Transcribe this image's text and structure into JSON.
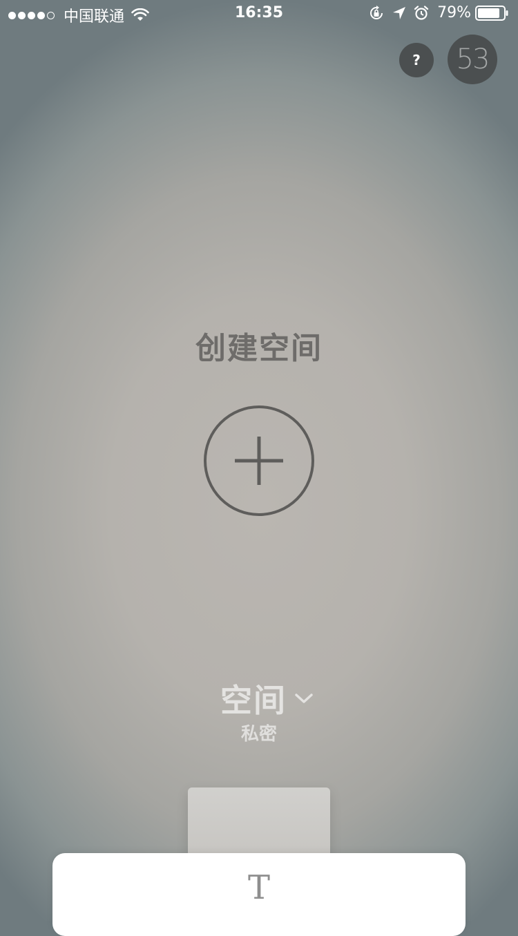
{
  "status_bar": {
    "carrier": "中国联通",
    "time": "16:35",
    "battery": "79%",
    "signal_bars_filled": 4,
    "signal_bars_total": 5
  },
  "header": {
    "help_label": "?",
    "count": "53"
  },
  "main": {
    "title": "创建空间",
    "add_icon": "plus-circle-icon"
  },
  "space_selector": {
    "name": "空间",
    "type": "私密"
  },
  "bottom": {
    "text_card_icon": "T"
  },
  "colors": {
    "button_dark": "#4b4f50",
    "title_text": "#6e6c6a",
    "selector_text": "#e4e3e1"
  }
}
